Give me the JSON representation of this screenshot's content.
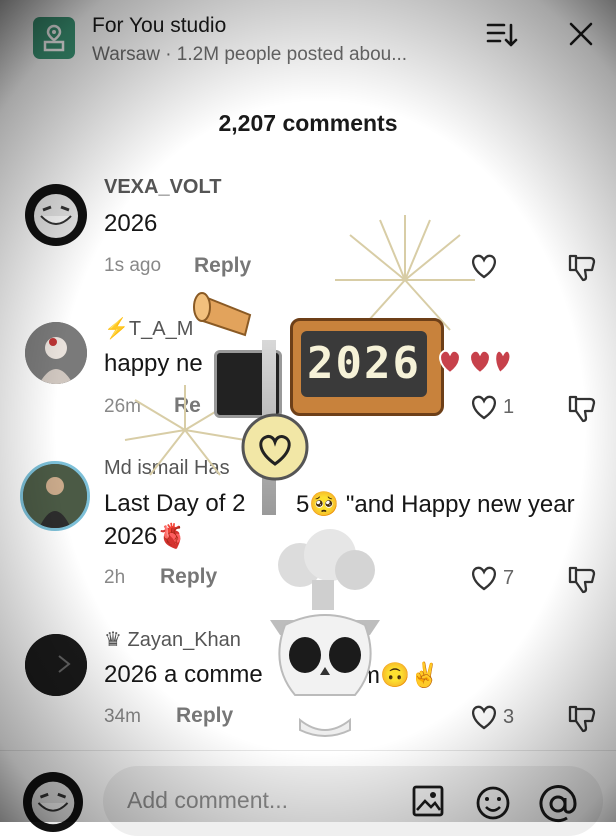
{
  "header": {
    "title": "For You studio",
    "subtitle": "Warsaw · 1.2M people posted abou..."
  },
  "comments_count": "2,207 comments",
  "comments": [
    {
      "username": "VEXA_VOLT",
      "text": "2026",
      "time": "1s ago",
      "reply": "Reply",
      "likes": ""
    },
    {
      "username": "⚡T_A_M",
      "text": "happy ne",
      "time": "26m",
      "reply": "Re",
      "likes": "1"
    },
    {
      "username": "Md ismail Has",
      "text": "Last Day of 2",
      "text_b": "5🥺 \"and Happy new year",
      "text2": "2026🫀",
      "time": "2h",
      "reply": "Reply",
      "likes": "7"
    },
    {
      "username": "♛ Zayan_Khan",
      "text": "2026 a comme",
      "text_b": "m🙃✌️",
      "time": "34m",
      "reply": "Reply",
      "likes": "3"
    }
  ],
  "sticker": {
    "year": "2026"
  },
  "input": {
    "placeholder": "Add comment..."
  },
  "colors": {
    "location_icon": "#3d9a79",
    "text_primary": "#161616",
    "text_secondary": "#888888"
  },
  "icons": [
    "location-pin-icon",
    "sort-icon",
    "close-icon",
    "heart-icon",
    "thumbs-down-icon",
    "image-icon",
    "emoji-icon",
    "mention-icon"
  ]
}
